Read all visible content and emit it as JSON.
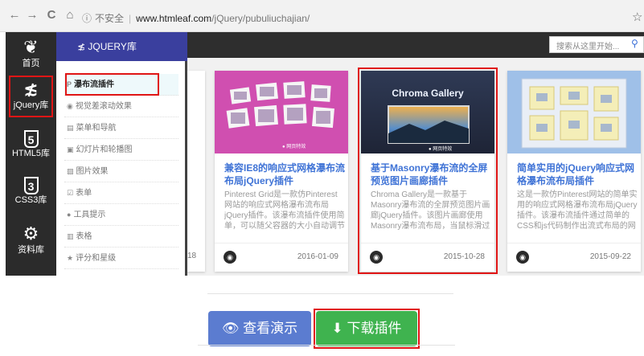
{
  "browser": {
    "nav": {
      "back": "←",
      "forward": "→",
      "reload": "C",
      "home": "⌂"
    },
    "security_icon": "info-circle-icon",
    "insecure_label": "不安全",
    "url_host": "www.htmleaf.com",
    "url_path": "/jQuery/pubuliuchajian/",
    "bookmark_star": "☆"
  },
  "sidebar": {
    "items": [
      {
        "label": "首页",
        "icon": "leaf-icon",
        "glyph": "❦"
      },
      {
        "label": "jQuery库",
        "icon": "jquery-icon",
        "glyph": "≴"
      },
      {
        "label": "HTML5库",
        "icon": "html5-icon",
        "glyph": "5"
      },
      {
        "label": "CSS3库",
        "icon": "css3-icon",
        "glyph": "3"
      },
      {
        "label": "资料库",
        "icon": "gear-icon",
        "glyph": "⚙"
      }
    ]
  },
  "panel": {
    "title": "≴ JQUERY库",
    "items": [
      {
        "label": "瀑布流插件",
        "icon": "P"
      },
      {
        "label": "视觉差滚动效果",
        "icon": "◉"
      },
      {
        "label": "菜单和导航",
        "icon": "▤"
      },
      {
        "label": "幻灯片和轮播图",
        "icon": "▣"
      },
      {
        "label": "图片效果",
        "icon": "▨"
      },
      {
        "label": "表单",
        "icon": "☑"
      },
      {
        "label": "工具提示",
        "icon": "●"
      },
      {
        "label": "表格",
        "icon": "▥"
      },
      {
        "label": "评分和星级",
        "icon": "★"
      }
    ]
  },
  "search": {
    "placeholder": "搜索从这里开始...",
    "icon": "search-icon",
    "glyph": "🔍"
  },
  "partial_card": {
    "date": "18"
  },
  "cards": [
    {
      "title": "兼容IE8的响应式网格瀑布流布局jQuery插件",
      "desc": "Pinterest Grid是一款仿Pinterest网站的响应式网格瀑布流布局jQuery插件。该瀑布流插件使用简单，可以随父容器的大小自动调节",
      "date": "2016-01-09",
      "thumb_colors": [
        "#d04fb0",
        "#f5f5f5"
      ]
    },
    {
      "title": "基于Masonry瀑布流的全屏预览图片画廊插件",
      "desc": "Chroma Gallery是一款基于Masonry瀑布流的全屏预览图片画廊jQuery插件。该图片画廊使用Masonry瀑布流布局，当鼠标滑过",
      "date": "2015-10-28",
      "thumb_label": "Chroma Gallery",
      "thumb_colors": [
        "#2f3a55",
        "#f2b14b"
      ]
    },
    {
      "title": "简单实用的jQuery响应式网格瀑布流布局插件",
      "desc": "这是一款仿Pinterest网站的简单实用的响应式网格瀑布流布局jQuery插件。该瀑布流插件通过简单的CSS和js代码制作出流式布局的网格",
      "date": "2015-09-22",
      "thumb_colors": [
        "#9fc0e8",
        "#f4eeb8"
      ]
    }
  ],
  "buttons": {
    "demo": {
      "icon": "eye-icon",
      "glyph": "👁",
      "label": "查看演示"
    },
    "download": {
      "icon": "download-icon",
      "glyph": "⬇",
      "label": "下载插件"
    }
  },
  "colors": {
    "highlight": "#e01515",
    "panel_header": "#3a3f9e",
    "link_blue": "#3f73d6",
    "demo_button": "#5b7cd0",
    "download_button": "#3fb34f"
  }
}
